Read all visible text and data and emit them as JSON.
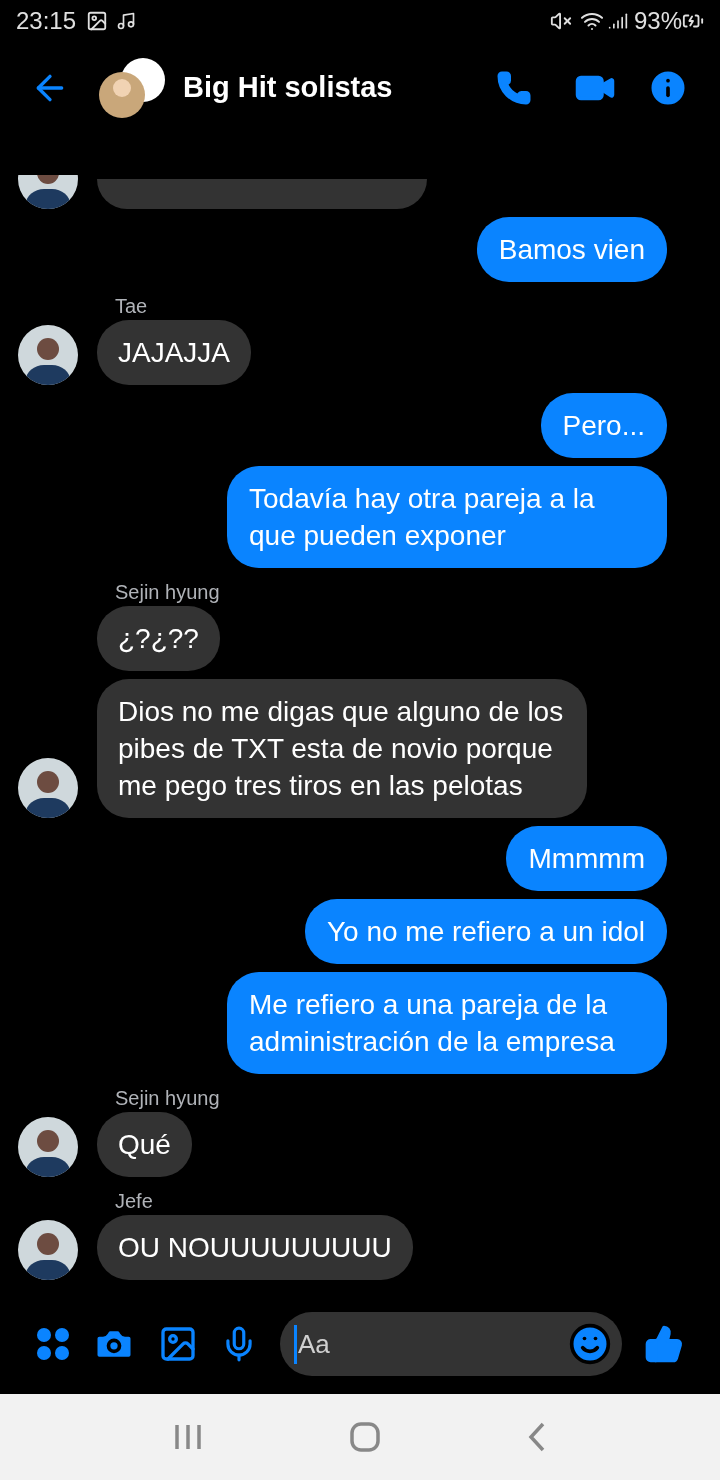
{
  "status_bar": {
    "time": "23:15",
    "battery": "93%"
  },
  "header": {
    "title": "Big Hit solistas"
  },
  "messages": [
    {
      "kind": "incoming_cut",
      "avatar": true
    },
    {
      "kind": "outgoing",
      "text": "Bamos vien"
    },
    {
      "kind": "incoming",
      "sender": "Tae",
      "text": "JAJAJJA",
      "avatar": true
    },
    {
      "kind": "outgoing",
      "text": "Pero..."
    },
    {
      "kind": "outgoing",
      "text": "Todavía hay otra pareja a la que pueden exponer"
    },
    {
      "kind": "incoming",
      "sender": "Sejin hyung",
      "text": "¿?¿??",
      "avatar": false
    },
    {
      "kind": "incoming",
      "text": "Dios no me digas que alguno de los pibes de TXT esta de novio porque me pego tres tiros en las pelotas",
      "avatar": true
    },
    {
      "kind": "outgoing",
      "text": "Mmmmm"
    },
    {
      "kind": "outgoing",
      "text": "Yo no me refiero a un idol"
    },
    {
      "kind": "outgoing",
      "text": "Me refiero a una pareja de la administración de la empresa"
    },
    {
      "kind": "incoming",
      "sender": "Sejin hyung",
      "text": "Qué",
      "avatar": true
    },
    {
      "kind": "incoming",
      "sender": "Jefe",
      "text": "OU NOUUUUUUUUU",
      "avatar": true
    }
  ],
  "composer": {
    "placeholder": "Aa"
  }
}
